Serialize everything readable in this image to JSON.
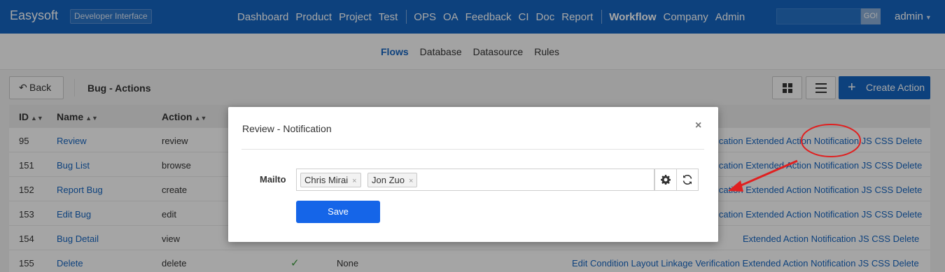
{
  "topbar": {
    "brand": "Easysoft",
    "badge": "Developer Interface",
    "nav_group1": [
      "Dashboard",
      "Product",
      "Project",
      "Test"
    ],
    "nav_group2": [
      "OPS",
      "OA",
      "Feedback",
      "CI",
      "Doc",
      "Report"
    ],
    "nav_group3": [
      "Workflow",
      "Company",
      "Admin"
    ],
    "search_button": "GO!",
    "user": "admin"
  },
  "subnav": {
    "items": [
      "Flows",
      "Database",
      "Datasource",
      "Rules"
    ]
  },
  "page": {
    "back_label": "Back",
    "title": "Bug - Actions",
    "create_label": "Create Action"
  },
  "table": {
    "headers": [
      "ID",
      "Name",
      "Action"
    ],
    "rows": [
      {
        "id": "95",
        "name": "Review",
        "action": "review"
      },
      {
        "id": "151",
        "name": "Bug List",
        "action": "browse"
      },
      {
        "id": "152",
        "name": "Report Bug",
        "action": "create"
      },
      {
        "id": "153",
        "name": "Edit Bug",
        "action": "edit"
      },
      {
        "id": "154",
        "name": "Bug Detail",
        "action": "view"
      },
      {
        "id": "155",
        "name": "Delete",
        "action": "delete",
        "mark": "✓",
        "none": "None"
      }
    ],
    "row_actions_tail": {
      "cut1": "ication Extended Action Notification JS CSS Delete",
      "cut2": "ication Extended Action Notification JS CSS Delete",
      "cut3": "ication Extended Action Notification JS CSS Delete",
      "cut4": "ication Extended Action Notification JS CSS Delete",
      "cut5": "Extended Action Notification JS CSS Delete",
      "full": "Edit Condition Layout Linkage Verification Extended Action Notification JS CSS Delete"
    }
  },
  "modal": {
    "title": "Review - Notification",
    "close": "×",
    "mailto_label": "Mailto",
    "tags": [
      "Chris Mirai",
      "Jon Zuo"
    ],
    "tag_remove": "×",
    "save_label": "Save"
  },
  "colors": {
    "primary": "#1565c0",
    "annotation": "#e02020"
  }
}
